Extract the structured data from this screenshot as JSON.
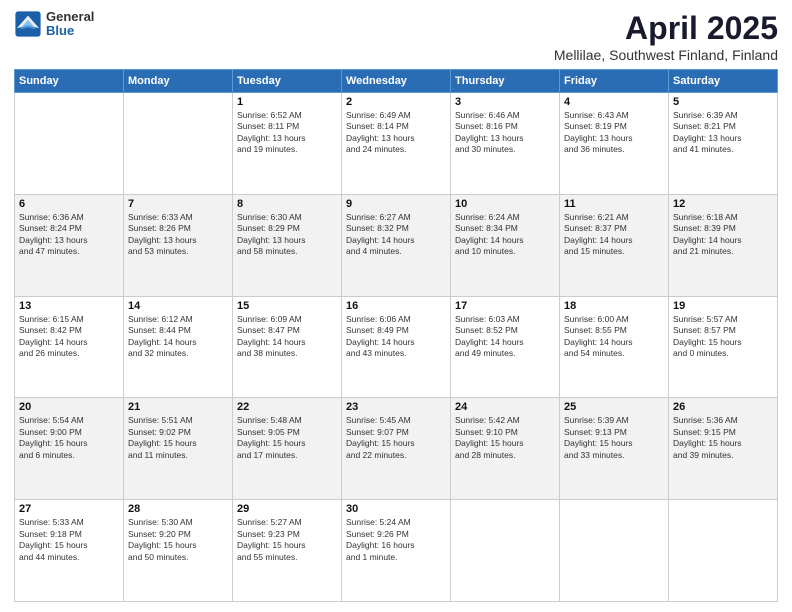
{
  "header": {
    "logo": {
      "general": "General",
      "blue": "Blue"
    },
    "title": "April 2025",
    "subtitle": "Mellilae, Southwest Finland, Finland"
  },
  "weekdays": [
    "Sunday",
    "Monday",
    "Tuesday",
    "Wednesday",
    "Thursday",
    "Friday",
    "Saturday"
  ],
  "weeks": [
    [
      {
        "day": "",
        "info": ""
      },
      {
        "day": "",
        "info": ""
      },
      {
        "day": "1",
        "info": "Sunrise: 6:52 AM\nSunset: 8:11 PM\nDaylight: 13 hours\nand 19 minutes."
      },
      {
        "day": "2",
        "info": "Sunrise: 6:49 AM\nSunset: 8:14 PM\nDaylight: 13 hours\nand 24 minutes."
      },
      {
        "day": "3",
        "info": "Sunrise: 6:46 AM\nSunset: 8:16 PM\nDaylight: 13 hours\nand 30 minutes."
      },
      {
        "day": "4",
        "info": "Sunrise: 6:43 AM\nSunset: 8:19 PM\nDaylight: 13 hours\nand 36 minutes."
      },
      {
        "day": "5",
        "info": "Sunrise: 6:39 AM\nSunset: 8:21 PM\nDaylight: 13 hours\nand 41 minutes."
      }
    ],
    [
      {
        "day": "6",
        "info": "Sunrise: 6:36 AM\nSunset: 8:24 PM\nDaylight: 13 hours\nand 47 minutes."
      },
      {
        "day": "7",
        "info": "Sunrise: 6:33 AM\nSunset: 8:26 PM\nDaylight: 13 hours\nand 53 minutes."
      },
      {
        "day": "8",
        "info": "Sunrise: 6:30 AM\nSunset: 8:29 PM\nDaylight: 13 hours\nand 58 minutes."
      },
      {
        "day": "9",
        "info": "Sunrise: 6:27 AM\nSunset: 8:32 PM\nDaylight: 14 hours\nand 4 minutes."
      },
      {
        "day": "10",
        "info": "Sunrise: 6:24 AM\nSunset: 8:34 PM\nDaylight: 14 hours\nand 10 minutes."
      },
      {
        "day": "11",
        "info": "Sunrise: 6:21 AM\nSunset: 8:37 PM\nDaylight: 14 hours\nand 15 minutes."
      },
      {
        "day": "12",
        "info": "Sunrise: 6:18 AM\nSunset: 8:39 PM\nDaylight: 14 hours\nand 21 minutes."
      }
    ],
    [
      {
        "day": "13",
        "info": "Sunrise: 6:15 AM\nSunset: 8:42 PM\nDaylight: 14 hours\nand 26 minutes."
      },
      {
        "day": "14",
        "info": "Sunrise: 6:12 AM\nSunset: 8:44 PM\nDaylight: 14 hours\nand 32 minutes."
      },
      {
        "day": "15",
        "info": "Sunrise: 6:09 AM\nSunset: 8:47 PM\nDaylight: 14 hours\nand 38 minutes."
      },
      {
        "day": "16",
        "info": "Sunrise: 6:06 AM\nSunset: 8:49 PM\nDaylight: 14 hours\nand 43 minutes."
      },
      {
        "day": "17",
        "info": "Sunrise: 6:03 AM\nSunset: 8:52 PM\nDaylight: 14 hours\nand 49 minutes."
      },
      {
        "day": "18",
        "info": "Sunrise: 6:00 AM\nSunset: 8:55 PM\nDaylight: 14 hours\nand 54 minutes."
      },
      {
        "day": "19",
        "info": "Sunrise: 5:57 AM\nSunset: 8:57 PM\nDaylight: 15 hours\nand 0 minutes."
      }
    ],
    [
      {
        "day": "20",
        "info": "Sunrise: 5:54 AM\nSunset: 9:00 PM\nDaylight: 15 hours\nand 6 minutes."
      },
      {
        "day": "21",
        "info": "Sunrise: 5:51 AM\nSunset: 9:02 PM\nDaylight: 15 hours\nand 11 minutes."
      },
      {
        "day": "22",
        "info": "Sunrise: 5:48 AM\nSunset: 9:05 PM\nDaylight: 15 hours\nand 17 minutes."
      },
      {
        "day": "23",
        "info": "Sunrise: 5:45 AM\nSunset: 9:07 PM\nDaylight: 15 hours\nand 22 minutes."
      },
      {
        "day": "24",
        "info": "Sunrise: 5:42 AM\nSunset: 9:10 PM\nDaylight: 15 hours\nand 28 minutes."
      },
      {
        "day": "25",
        "info": "Sunrise: 5:39 AM\nSunset: 9:13 PM\nDaylight: 15 hours\nand 33 minutes."
      },
      {
        "day": "26",
        "info": "Sunrise: 5:36 AM\nSunset: 9:15 PM\nDaylight: 15 hours\nand 39 minutes."
      }
    ],
    [
      {
        "day": "27",
        "info": "Sunrise: 5:33 AM\nSunset: 9:18 PM\nDaylight: 15 hours\nand 44 minutes."
      },
      {
        "day": "28",
        "info": "Sunrise: 5:30 AM\nSunset: 9:20 PM\nDaylight: 15 hours\nand 50 minutes."
      },
      {
        "day": "29",
        "info": "Sunrise: 5:27 AM\nSunset: 9:23 PM\nDaylight: 15 hours\nand 55 minutes."
      },
      {
        "day": "30",
        "info": "Sunrise: 5:24 AM\nSunset: 9:26 PM\nDaylight: 16 hours\nand 1 minute."
      },
      {
        "day": "",
        "info": ""
      },
      {
        "day": "",
        "info": ""
      },
      {
        "day": "",
        "info": ""
      }
    ]
  ]
}
